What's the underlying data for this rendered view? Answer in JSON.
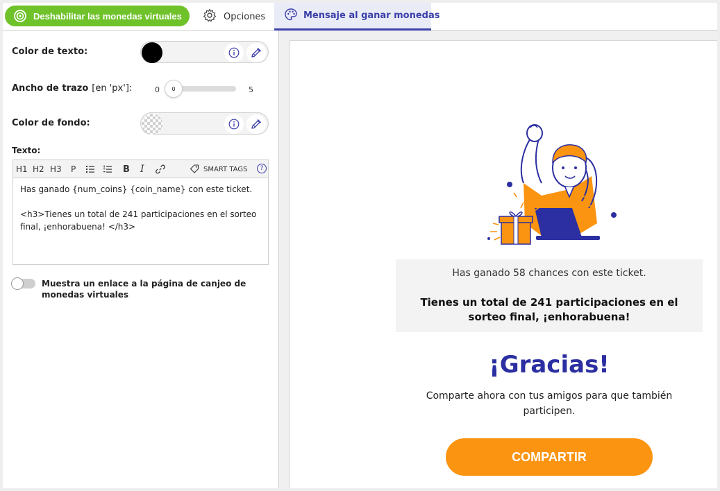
{
  "header": {
    "disable_button_label": "Deshabilitar las monedas virtuales",
    "tabs": [
      {
        "label": "Opciones",
        "icon": "gear-icon",
        "active": false
      },
      {
        "label": "Mensaje al ganar monedas",
        "icon": "palette-icon",
        "active": true
      }
    ]
  },
  "settings": {
    "text_color": {
      "label": "Color de texto:",
      "value": "#000000"
    },
    "stroke_width": {
      "label": "Ancho de trazo",
      "unit": "[en 'px']:",
      "min": "0",
      "max": "5",
      "value": "0"
    },
    "background_color": {
      "label": "Color de fondo:",
      "value": "transparent"
    },
    "text": {
      "label": "Texto:",
      "toolbar": [
        "H1",
        "H2",
        "H3",
        "P"
      ],
      "smart_tags_label": "SMART TAGS",
      "help_label": "?",
      "content_line1": "Has ganado {num_coins} {coin_name} con este ticket.",
      "content_line2": "<h3>Tienes un total de 241 participaciones en el sorteo final, ¡enhorabuena! </h3>"
    },
    "redeem_link_toggle": {
      "label": "Muestra un enlace a la página de canjeo de monedas virtuales",
      "on": false
    }
  },
  "preview": {
    "message_line1": "Has ganado 58 chances con este ticket.",
    "message_line2": "Tienes un total de 241 participaciones en el sorteo final, ¡enhorabuena!",
    "thanks": "¡Gracias!",
    "share_text": "Comparte ahora con tus amigos para que también participen.",
    "share_button": "COMPARTIR"
  },
  "colors": {
    "accent_green": "#6fc22a",
    "accent_blue": "#3b3fa8",
    "title_blue": "#2c2fa1",
    "share_orange": "#fb9410"
  }
}
